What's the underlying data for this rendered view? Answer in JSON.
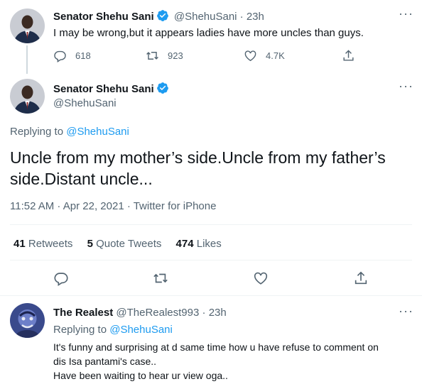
{
  "tweet1": {
    "author_name": "Senator Shehu Sani",
    "handle": "@ShehuSani",
    "time": "23h",
    "text": "I may be wrong,but it appears ladies have more uncles than guys.",
    "replies": "618",
    "retweets": "923",
    "likes": "4.7K"
  },
  "main_tweet": {
    "author_name": "Senator Shehu Sani",
    "handle": "@ShehuSani",
    "replying_prefix": "Replying to",
    "replying_handle": "@ShehuSani",
    "text": "Uncle from my mother’s side.Uncle from my father’s side.Distant uncle...",
    "timestamp": "11:52 AM · Apr 22, 2021 · Twitter for iPhone",
    "retweets_count": "41",
    "retweets_label": "Retweets",
    "quotes_count": "5",
    "quotes_label": "Quote Tweets",
    "likes_count": "474",
    "likes_label": "Likes"
  },
  "reply": {
    "author_name": "The Realest",
    "handle": "@TheRealest993",
    "time": "23h",
    "replying_prefix": "Replying to",
    "replying_handle": "@ShehuSani",
    "line1": "It's funny and surprising at d same time how u have refuse to comment on",
    "line2": "dis Isa pantami's case..",
    "line3": "Have been waiting to hear ur view oga.."
  },
  "colors": {
    "accent": "#1d9bf0",
    "secondary_text": "#536471",
    "divider": "#eff3f4"
  },
  "icons": [
    "verified-badge-icon",
    "more-icon",
    "reply-icon",
    "retweet-icon",
    "like-icon",
    "share-icon"
  ]
}
